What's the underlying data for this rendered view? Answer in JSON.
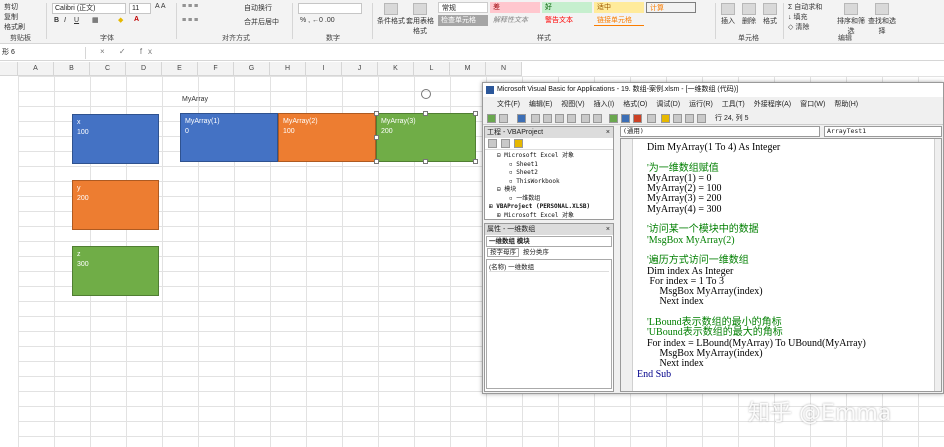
{
  "ribbon": {
    "clipboard": {
      "cut": "剪切",
      "copy": "复制",
      "format_painter": "格式刷",
      "label": "剪贴板"
    },
    "font": {
      "name": "Calibri (正文)",
      "size": "11",
      "label": "字体"
    },
    "alignment": {
      "wrap": "自动换行",
      "merge": "合并后居中",
      "label": "对齐方式"
    },
    "number": {
      "label": "数字"
    },
    "styles": {
      "label": "样式",
      "conditional": "条件格式",
      "table": "套用表格格式",
      "chips": [
        "常规",
        "差",
        "好",
        "适中",
        "计算",
        "检查单元格",
        "解释性文本",
        "警告文本",
        "链接单元格"
      ]
    },
    "cells": {
      "insert": "插入",
      "delete": "删除",
      "format": "格式",
      "label": "单元格"
    },
    "editing": {
      "autosum": "自动求和",
      "fill": "填充",
      "clear": "清除",
      "sort_filter": "排序和筛选",
      "find_select": "查找和选择",
      "label": "编辑"
    }
  },
  "formula_bar": {
    "name_box": "形 6",
    "icons": "× ✓ fx"
  },
  "sheet": {
    "columns": [
      "A",
      "B",
      "C",
      "D",
      "E",
      "F",
      "G",
      "H",
      "I",
      "J",
      "K",
      "L",
      "M",
      "N"
    ],
    "title_label": "MyArray",
    "shapes": [
      {
        "name": "x",
        "value": "100",
        "color": "blue"
      },
      {
        "name": "y",
        "value": "200",
        "color": "orange"
      },
      {
        "name": "z",
        "value": "300",
        "color": "green"
      }
    ],
    "array": [
      {
        "name": "MyArray(1)",
        "value": "0",
        "color": "blue"
      },
      {
        "name": "MyArray(2)",
        "value": "100",
        "color": "orange"
      },
      {
        "name": "MyArray(3)",
        "value": "200",
        "color": "green"
      }
    ]
  },
  "vba": {
    "title": "Microsoft Visual Basic for Applications - 19. 数组-案例.xlsm - [一维数组 (代码)]",
    "menu": [
      "文件(F)",
      "编辑(E)",
      "视图(V)",
      "插入(I)",
      "格式(O)",
      "调试(D)",
      "运行(R)",
      "工具(T)",
      "外接程序(A)",
      "窗口(W)",
      "帮助(H)"
    ],
    "cursor_pos": "行 24, 列 5",
    "project_panel": {
      "title": "工程 - VBAProject",
      "tree": [
        "Microsoft Excel 对象",
        "Sheet1",
        "Sheet2",
        "ThisWorkbook",
        "模块",
        "一维数组",
        "VBAProject (PERSONAL.XLSB)",
        "Microsoft Excel 对象"
      ]
    },
    "props_panel": {
      "title": "属性 - 一维数组",
      "object": "一维数组 模块",
      "tabs": [
        "按字母序",
        "按分类序"
      ],
      "row": "(名称) 一维数组"
    },
    "object_dropdown": "(通用)",
    "proc_dropdown": "ArrayTest1",
    "code": [
      {
        "t": "t",
        "s": "    Dim MyArray(1 To 4) As Integer"
      },
      {
        "t": "t",
        "s": ""
      },
      {
        "t": "c",
        "s": "    '为一维数组赋值"
      },
      {
        "t": "t",
        "s": "    MyArray(1) = 0"
      },
      {
        "t": "t",
        "s": "    MyArray(2) = 100"
      },
      {
        "t": "t",
        "s": "    MyArray(3) = 200"
      },
      {
        "t": "t",
        "s": "    MyArray(4) = 300"
      },
      {
        "t": "t",
        "s": ""
      },
      {
        "t": "c",
        "s": "    '访问某一个模块中的数据"
      },
      {
        "t": "c",
        "s": "    'MsgBox MyArray(2)"
      },
      {
        "t": "t",
        "s": ""
      },
      {
        "t": "c",
        "s": "    '遍历方式访问一维数组"
      },
      {
        "t": "t",
        "s": "    Dim index As Integer"
      },
      {
        "t": "t",
        "s": "     For index = 1 To 3"
      },
      {
        "t": "t",
        "s": "         MsgBox MyArray(index)"
      },
      {
        "t": "t",
        "s": "         Next index"
      },
      {
        "t": "t",
        "s": ""
      },
      {
        "t": "c",
        "s": "    'LBound表示数组的最小的角标"
      },
      {
        "t": "c",
        "s": "    'UBound表示数组的最大的角标"
      },
      {
        "t": "t",
        "s": "    For index = LBound(MyArray) To UBound(MyArray)"
      },
      {
        "t": "t",
        "s": "         MsgBox MyArray(index)"
      },
      {
        "t": "t",
        "s": "         Next index"
      },
      {
        "t": "k",
        "s": "End Sub"
      }
    ]
  },
  "watermark": "知乎 @Emma"
}
